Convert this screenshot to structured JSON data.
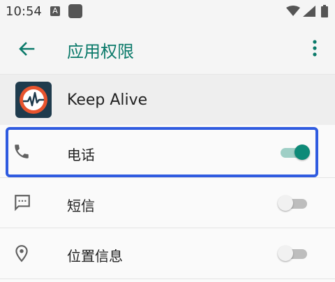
{
  "status_bar": {
    "time": "10:54",
    "notification_letter": "A"
  },
  "app_bar": {
    "title": "应用权限"
  },
  "app": {
    "name": "Keep Alive"
  },
  "permissions": [
    {
      "label": "电话",
      "icon": "phone-icon",
      "enabled": true
    },
    {
      "label": "短信",
      "icon": "sms-icon",
      "enabled": false
    },
    {
      "label": "位置信息",
      "icon": "location-icon",
      "enabled": false
    }
  ],
  "colors": {
    "accent": "#0e8a78",
    "title": "#0b7a6a",
    "highlight": "#2f5be0"
  }
}
